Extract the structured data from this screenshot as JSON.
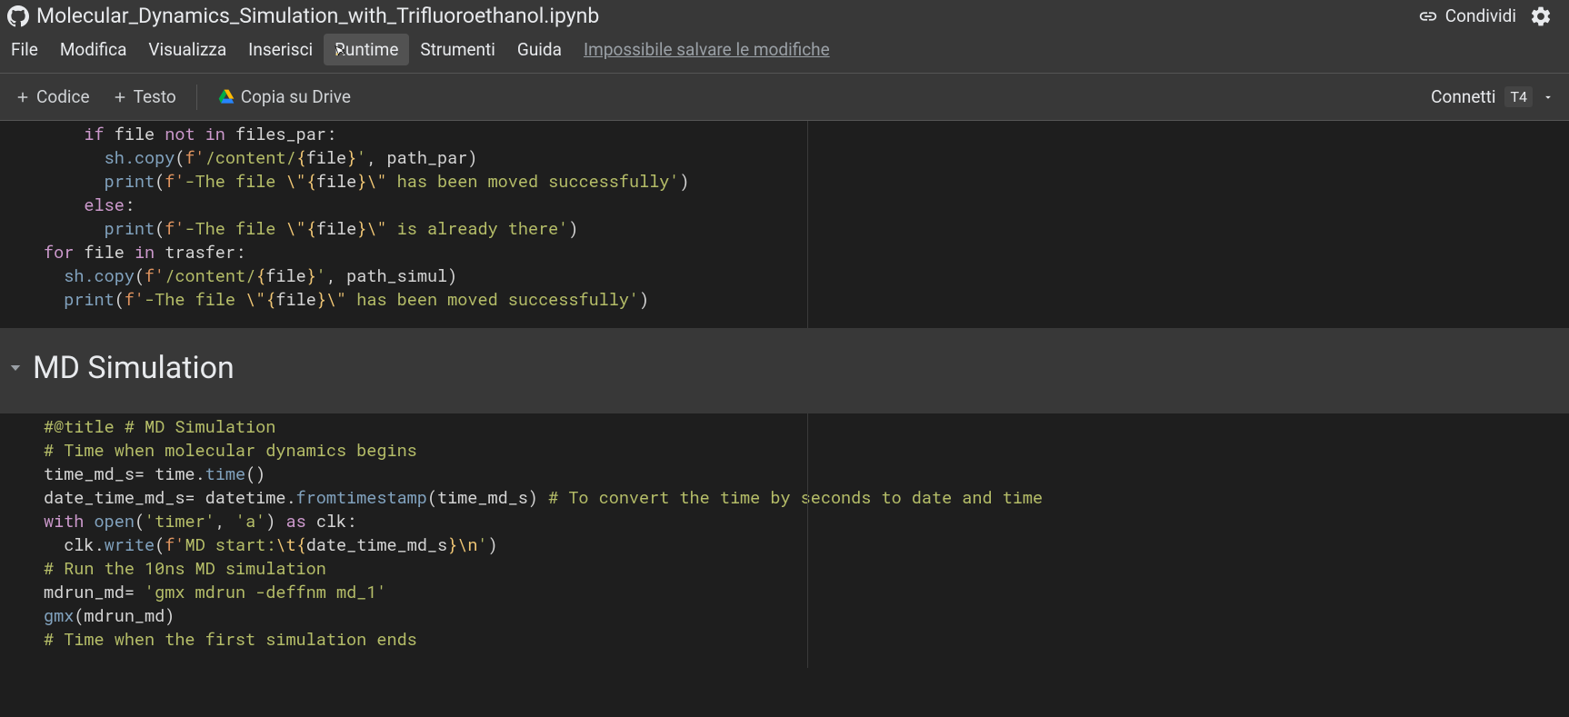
{
  "header": {
    "title": "Molecular_Dynamics_Simulation_with_Trifluoroethanol.ipynb",
    "share": "Condividi"
  },
  "menu": {
    "file": "File",
    "edit": "Modifica",
    "view": "Visualizza",
    "insert": "Inserisci",
    "runtime": "Runtime",
    "tools": "Strumenti",
    "help": "Guida",
    "status": "Impossibile salvare le modifiche"
  },
  "toolbar": {
    "code": "Codice",
    "text": "Testo",
    "copy_drive": "Copia su Drive",
    "connect": "Connetti",
    "runtime_type": "T4"
  },
  "cell1": {
    "gutter": "[ ]",
    "code": {
      "l1": {
        "kw": "if",
        "txt": " file ",
        "kw2": "not in",
        "txt2": " files_par:"
      },
      "l2": {
        "fn": "sh.copy",
        "op": "(",
        "sf": "f'",
        "s1": "/content/",
        "esc1": "{",
        "v1": "file",
        "esc2": "}",
        "s2": "'",
        "c1": ", path_par)"
      },
      "l3": {
        "bi": "print",
        "op": "(",
        "sf": "f'",
        "s1": "-The file ",
        "esc1": "\\\"{",
        "v1": "file",
        "esc2": "}\\\"",
        "s2": " has been moved successfully'",
        "cp": ")"
      },
      "l4": {
        "kw": "else",
        "col": ":"
      },
      "l5": {
        "bi": "print",
        "op": "(",
        "sf": "f'",
        "s1": "-The file ",
        "esc1": "\\\"{",
        "v1": "file",
        "esc2": "}\\\"",
        "s2": " is already there'",
        "cp": ")"
      },
      "l6": {
        "kw": "for",
        "v": " file ",
        "kw2": "in",
        "v2": " trasfer:"
      },
      "l7": {
        "fn": "sh.copy",
        "op": "(",
        "sf": "f'",
        "s1": "/content/",
        "esc1": "{",
        "v1": "file",
        "esc2": "}",
        "s2": "'",
        "c1": ", path_simul)"
      },
      "l8": {
        "bi": "print",
        "op": "(",
        "sf": "f'",
        "s1": "-The file ",
        "esc1": "\\\"{",
        "v1": "file",
        "esc2": "}\\\"",
        "s2": " has been moved successfully'",
        "cp": ")"
      }
    }
  },
  "text1": {
    "heading": "MD Simulation"
  },
  "cell2": {
    "gutter": "[ ]",
    "code": {
      "l1": {
        "c": "#@title # MD Simulation"
      },
      "l2": {
        "c": "# Time when molecular dynamics begins"
      },
      "l3": {
        "pre": "time_md_s= time.",
        "fn": "time",
        "post": "()"
      },
      "l4": {
        "pre": "date_time_md_s= datetime.",
        "fn": "fromtimestamp",
        "post": "(time_md_s) ",
        "c": "# To convert the time by seconds to date and time"
      },
      "l5": {
        "kw": "with",
        "sp": " ",
        "bi": "open",
        "op": "(",
        "s1": "'timer'",
        "c1": ", ",
        "s2": "'a'",
        "cp": ") ",
        "kw2": "as",
        "v": " clk:"
      },
      "l6": {
        "pre": "  clk.",
        "fn": "write",
        "op": "(",
        "sf": "f'",
        "s1": "MD start:",
        "esc1": "\\t{",
        "v1": "date_time_md_s",
        "esc2": "}\\n",
        "s2": "'",
        "cp": ")"
      },
      "l7": {
        "c": "# Run the 10ns MD simulation"
      },
      "l8": {
        "pre": "mdrun_md= ",
        "s": "'gmx mdrun -deffnm md_1'"
      },
      "l9": {
        "fn": "gmx",
        "post": "(mdrun_md)"
      },
      "l10": {
        "c": "# Time when the first simulation ends"
      }
    }
  }
}
